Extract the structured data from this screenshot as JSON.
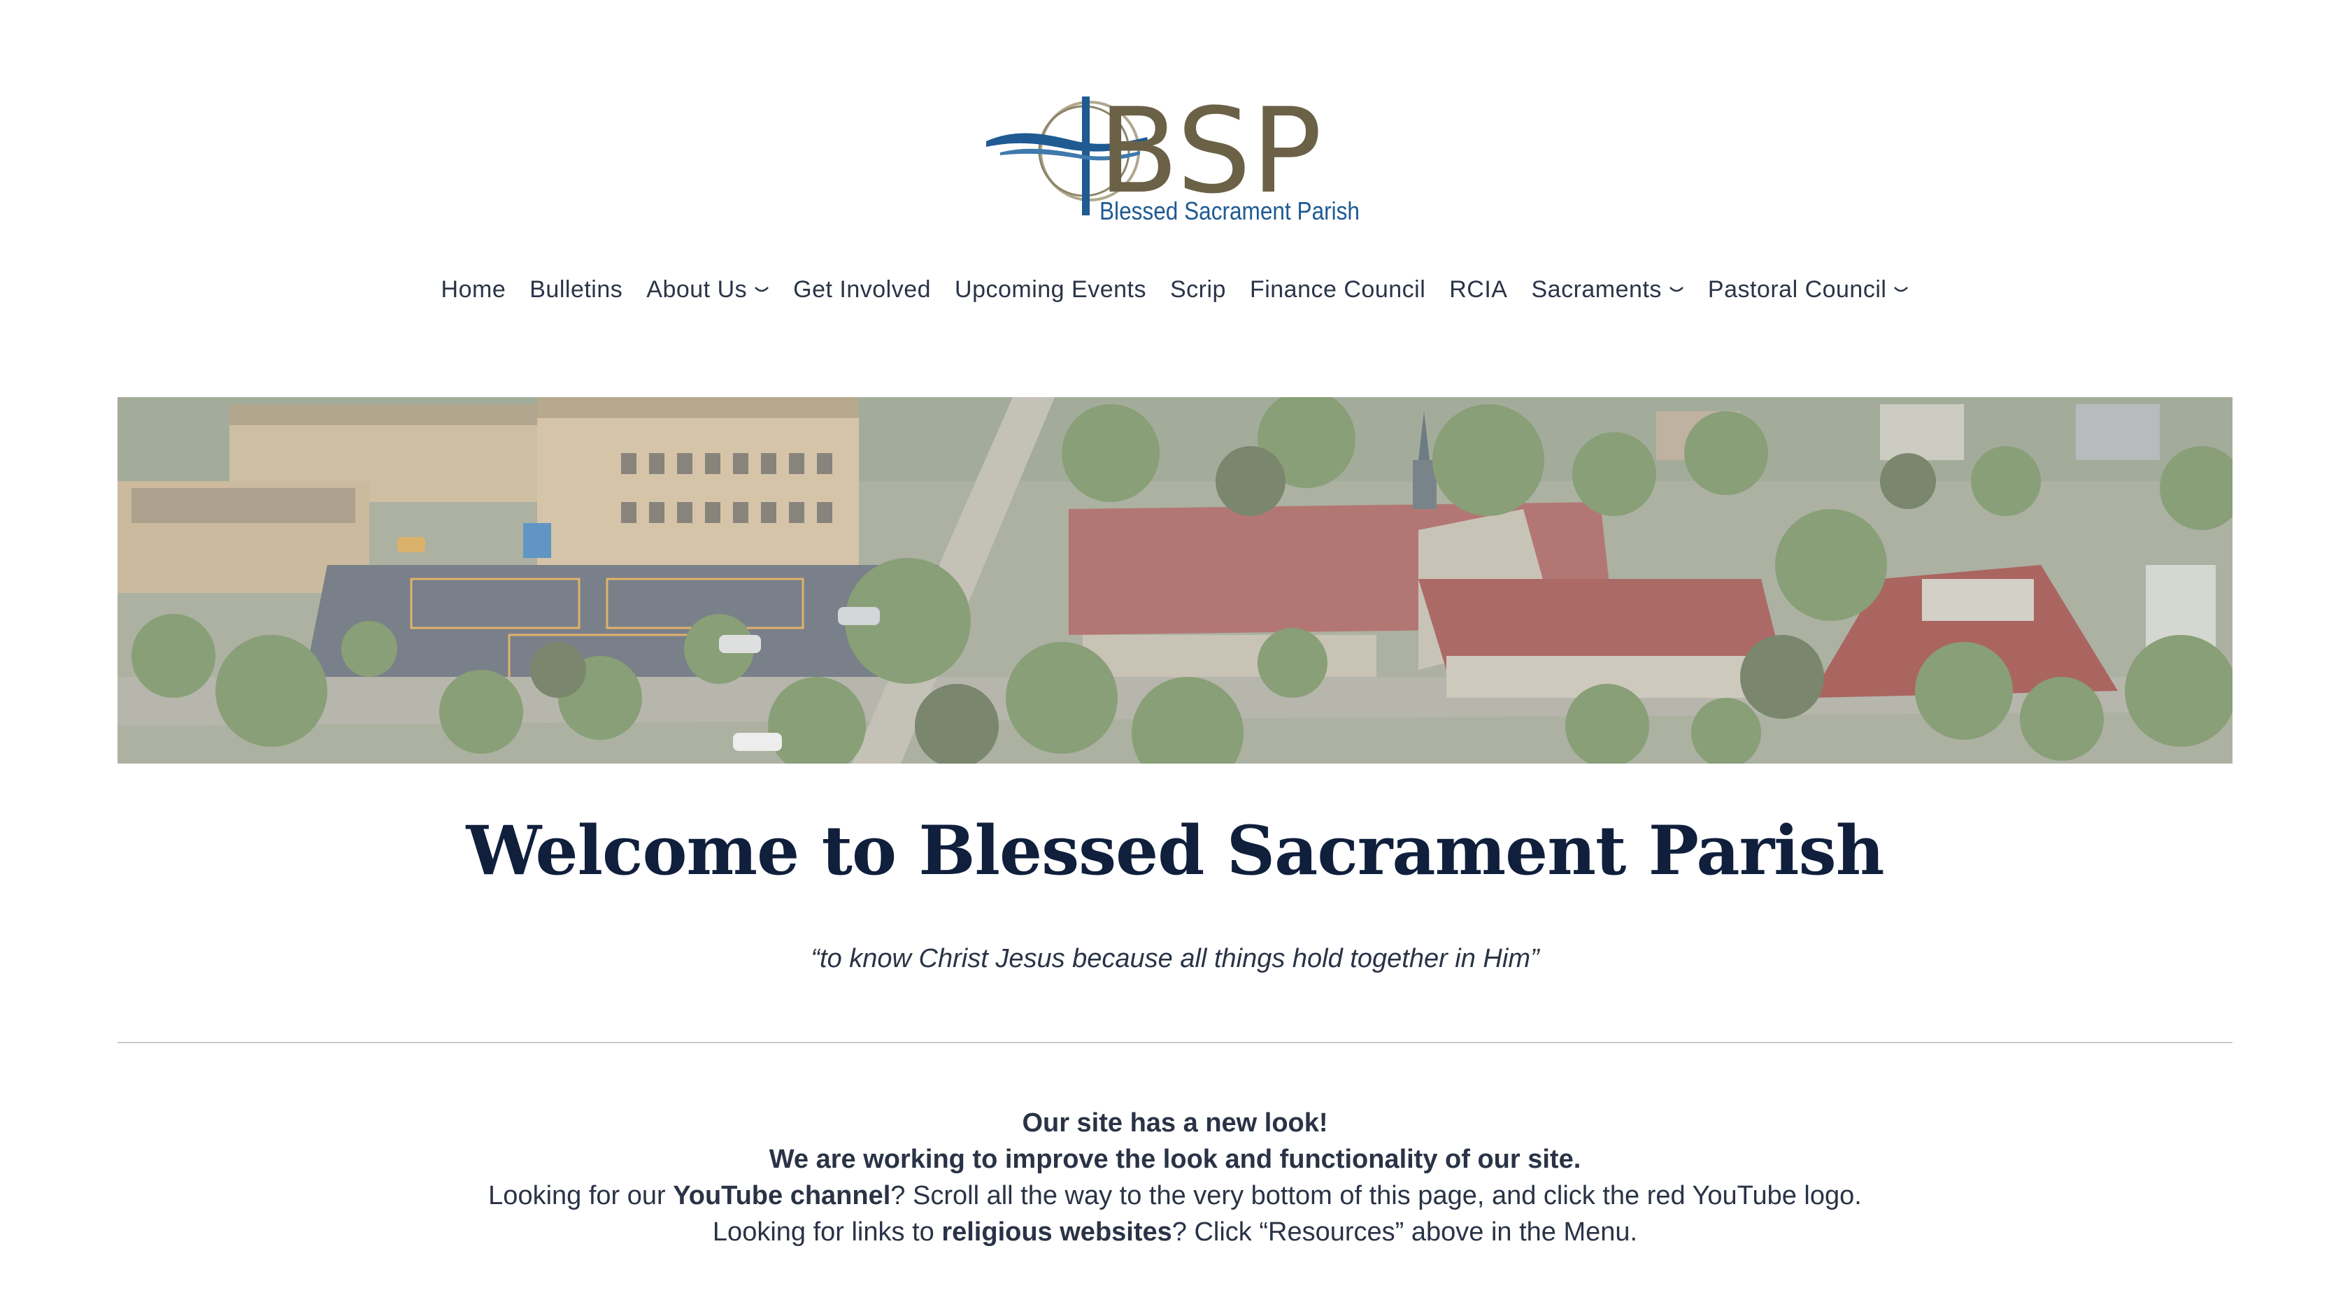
{
  "logo": {
    "initials": "BSP",
    "name": "Blessed Sacrament Parish"
  },
  "nav": {
    "items": [
      {
        "label": "Home",
        "dropdown": false
      },
      {
        "label": "Bulletins",
        "dropdown": false
      },
      {
        "label": "About Us",
        "dropdown": true
      },
      {
        "label": "Get Involved",
        "dropdown": false
      },
      {
        "label": "Upcoming Events",
        "dropdown": false
      },
      {
        "label": "Scrip",
        "dropdown": false
      },
      {
        "label": "Finance Council",
        "dropdown": false
      },
      {
        "label": "RCIA",
        "dropdown": false
      },
      {
        "label": "Sacraments",
        "dropdown": true
      },
      {
        "label": "Pastoral Council",
        "dropdown": true
      }
    ]
  },
  "main": {
    "title": "Welcome to Blessed Sacrament Parish",
    "tagline": "“to know Christ Jesus because all things hold together in Him”",
    "notice": {
      "line1": "Our site has a new look!",
      "line2": "We are working to improve the look and functionality of our site.",
      "line3_pre": "Looking for our ",
      "line3_bold": "YouTube channel",
      "line3_post": "? Scroll all the way to the very bottom of this page, and click the red YouTube logo.",
      "line4_pre": "Looking for links to ",
      "line4_bold": "religious websites",
      "line4_post": "? Click “Resources” above in the Menu."
    }
  },
  "colors": {
    "navy": "#0f1f3c",
    "logo_brown": "#6b6147",
    "logo_blue": "#1f5a92",
    "text": "#2a3346"
  }
}
